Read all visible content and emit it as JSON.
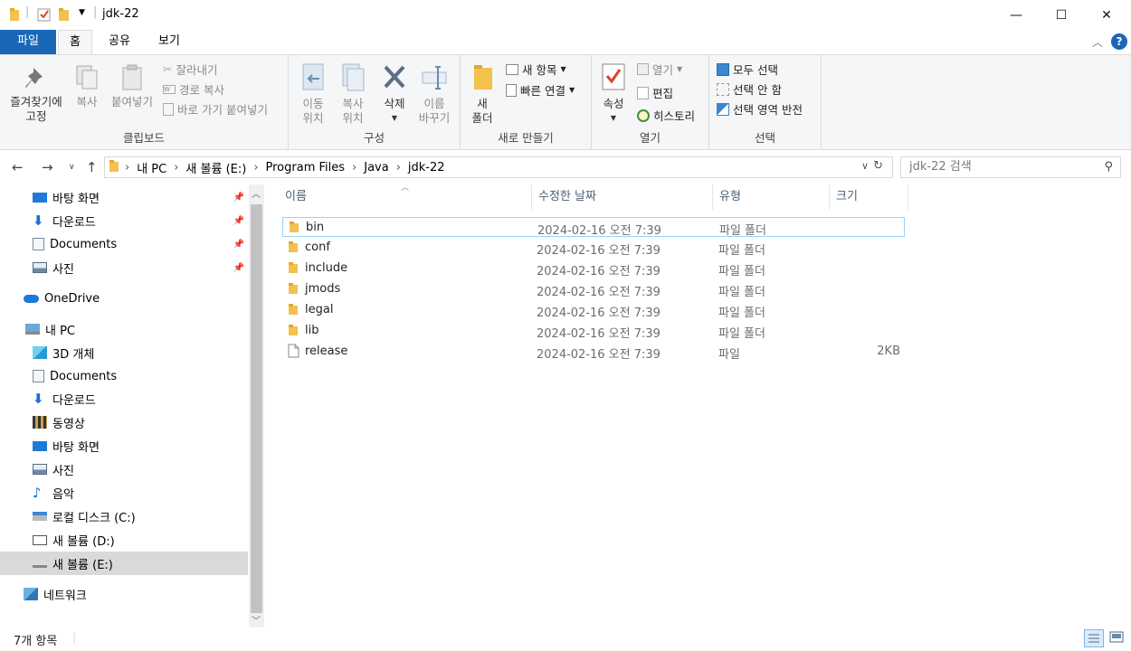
{
  "window": {
    "title": "jdk-22",
    "minimize": "—",
    "maximize": "☐",
    "close": "✕"
  },
  "tabs": [
    {
      "label": "파일"
    },
    {
      "label": "홈"
    },
    {
      "label": "공유"
    },
    {
      "label": "보기"
    }
  ],
  "ribbon": {
    "clipboard": {
      "label": "클립보드",
      "pin_quick_line1": "즐겨찾기에",
      "pin_quick_line2": "고정",
      "copy": "복사",
      "paste": "붙여넣기",
      "cut": "잘라내기",
      "copy_path": "경로 복사",
      "paste_shortcut": "바로 가기 붙여넣기"
    },
    "organize": {
      "label": "구성",
      "move_line1": "이동",
      "move_line2": "위치",
      "copy_line1": "복사",
      "copy_line2": "위치",
      "delete": "삭제",
      "rename_line1": "이름",
      "rename_line2": "바꾸기"
    },
    "new": {
      "label": "새로 만들기",
      "new_folder_line1": "새",
      "new_folder_line2": "폴더",
      "new_item": "새 항목",
      "easy_access": "빠른 연결"
    },
    "open": {
      "label": "열기",
      "properties": "속성",
      "open": "열기",
      "edit": "편집",
      "history": "히스토리"
    },
    "select": {
      "label": "선택",
      "select_all": "모두 선택",
      "select_none": "선택 안 함",
      "invert": "선택 영역 반전"
    }
  },
  "address": {
    "crumbs": [
      "내 PC",
      "새 볼륨 (E:)",
      "Program Files",
      "Java",
      "jdk-22"
    ],
    "search_placeholder": "jdk-22 검색"
  },
  "nav": {
    "quick": [
      {
        "label": "바탕 화면",
        "icon": "desktop-icon"
      },
      {
        "label": "다운로드",
        "icon": "download-icon"
      },
      {
        "label": "Documents",
        "icon": "document-icon"
      },
      {
        "label": "사진",
        "icon": "picture-icon"
      }
    ],
    "onedrive": "OneDrive",
    "thispc": "내 PC",
    "pc_items": [
      {
        "label": "3D 개체",
        "icon": "3d-objects-icon"
      },
      {
        "label": "Documents",
        "icon": "document-icon"
      },
      {
        "label": "다운로드",
        "icon": "download-icon"
      },
      {
        "label": "동영상",
        "icon": "video-icon"
      },
      {
        "label": "바탕 화면",
        "icon": "desktop-icon"
      },
      {
        "label": "사진",
        "icon": "picture-icon"
      },
      {
        "label": "음악",
        "icon": "music-icon"
      },
      {
        "label": "로컬 디스크 (C:)",
        "icon": "drive-icon"
      },
      {
        "label": "새 볼륨 (D:)",
        "icon": "drive-icon"
      },
      {
        "label": "새 볼륨 (E:)",
        "icon": "drive-icon"
      }
    ],
    "network": "네트워크"
  },
  "columns": {
    "name": "이름",
    "date": "수정한 날짜",
    "type": "유형",
    "size": "크기"
  },
  "files": [
    {
      "name": "bin",
      "date": "2024-02-16 오전 7:39",
      "type": "파일 폴더",
      "size": ""
    },
    {
      "name": "conf",
      "date": "2024-02-16 오전 7:39",
      "type": "파일 폴더",
      "size": ""
    },
    {
      "name": "include",
      "date": "2024-02-16 오전 7:39",
      "type": "파일 폴더",
      "size": ""
    },
    {
      "name": "jmods",
      "date": "2024-02-16 오전 7:39",
      "type": "파일 폴더",
      "size": ""
    },
    {
      "name": "legal",
      "date": "2024-02-16 오전 7:39",
      "type": "파일 폴더",
      "size": ""
    },
    {
      "name": "lib",
      "date": "2024-02-16 오전 7:39",
      "type": "파일 폴더",
      "size": ""
    },
    {
      "name": "release",
      "date": "2024-02-16 오전 7:39",
      "type": "파일",
      "size": "2KB"
    }
  ],
  "status": {
    "item_count": "7개 항목"
  },
  "colors": {
    "accent": "#1a67b8",
    "folder": "#f2c14e",
    "selected_nav": "#d9d9d9"
  }
}
